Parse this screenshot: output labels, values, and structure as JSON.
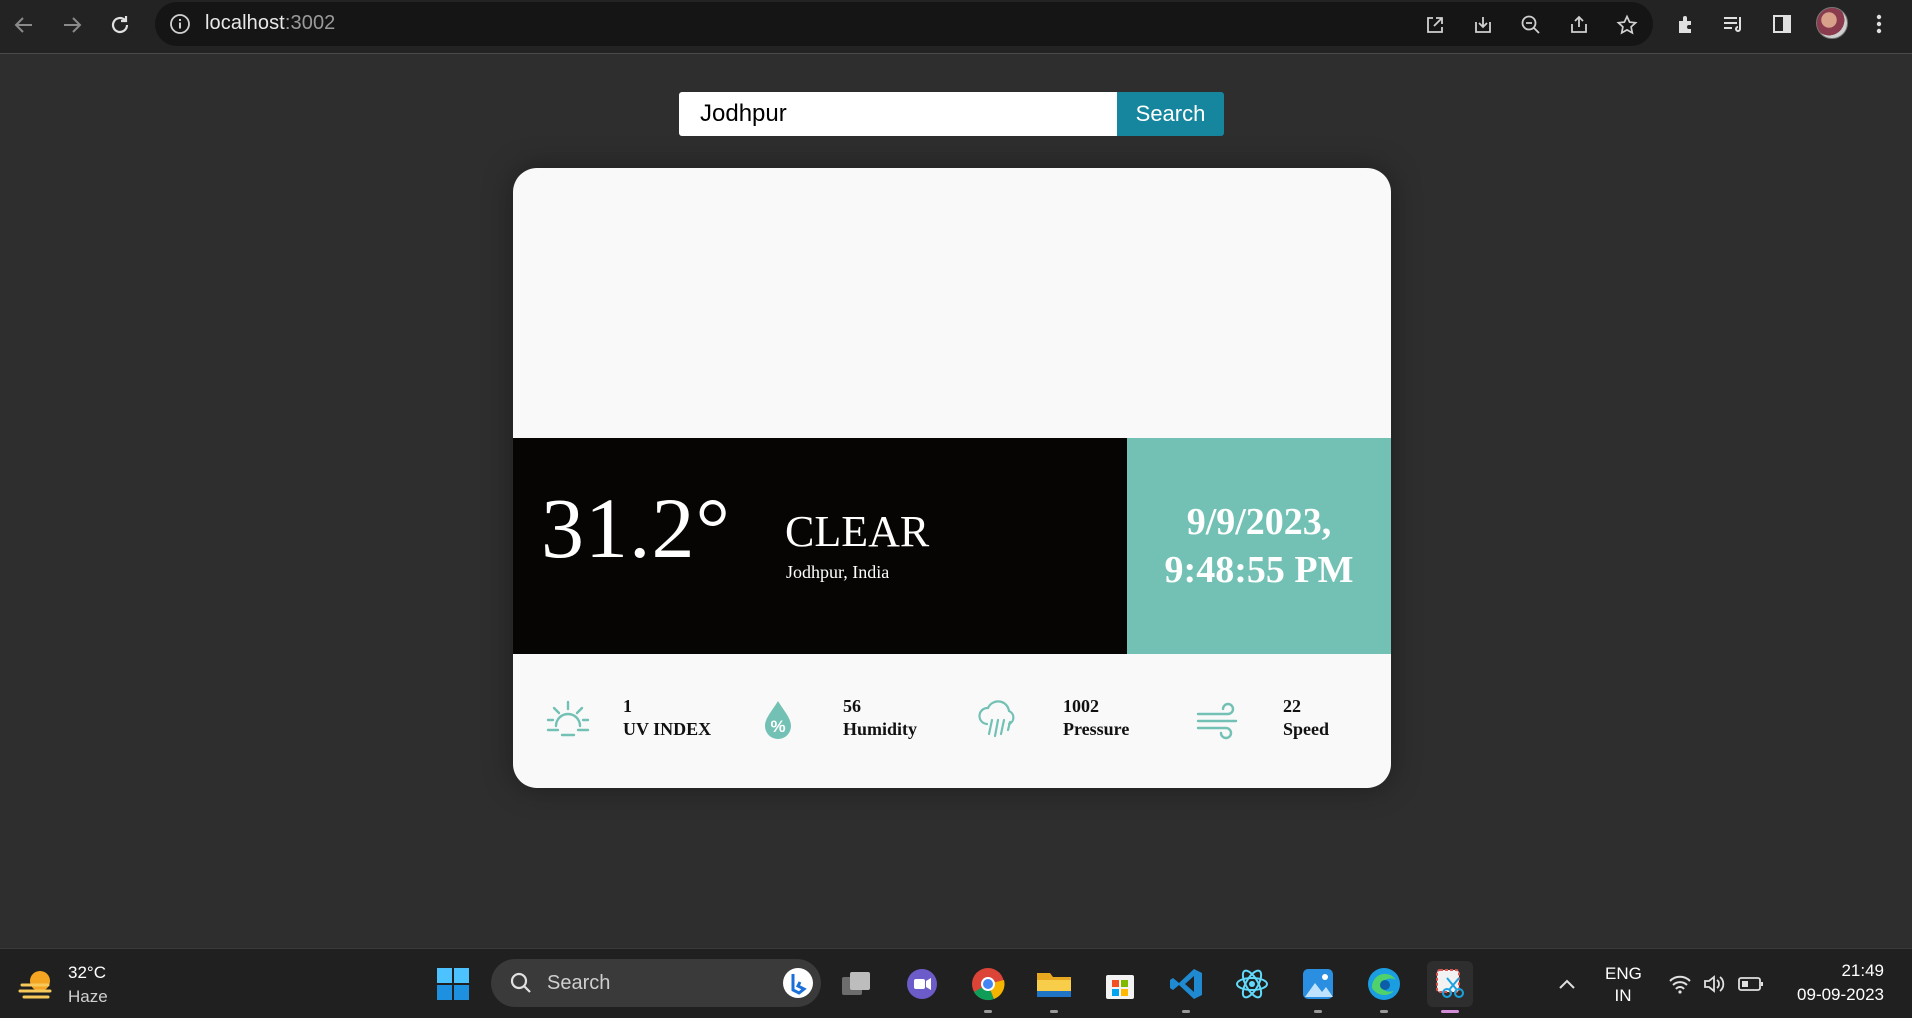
{
  "browser": {
    "url_host": "localhost",
    "url_port": ":3002"
  },
  "search": {
    "value": "Jodhpur",
    "button_label": "Search"
  },
  "weather": {
    "icon": "moon-icon",
    "temperature": "31.2°",
    "condition": "CLEAR",
    "location": "Jodhpur, India",
    "date_line": "9/9/2023,",
    "time_line": "9:48:55 PM",
    "colors": {
      "panel_dark": "#060503",
      "panel_teal": "#72c1b4",
      "icon_accent": "#72c1b4",
      "moon": "#1a73d8",
      "search_button": "#15869e"
    }
  },
  "stats": [
    {
      "icon": "sun-icon",
      "value": "1",
      "label": "UV INDEX"
    },
    {
      "icon": "humidity-drop-icon",
      "value": "56",
      "label": "Humidity"
    },
    {
      "icon": "rain-cloud-icon",
      "value": "1002",
      "label": "Pressure"
    },
    {
      "icon": "wind-icon",
      "value": "22",
      "label": "Speed"
    }
  ],
  "taskbar": {
    "weather_temp": "32°C",
    "weather_cond": "Haze",
    "search_label": "Search",
    "lang_line1": "ENG",
    "lang_line2": "IN",
    "time": "21:49",
    "date": "09-09-2023"
  }
}
